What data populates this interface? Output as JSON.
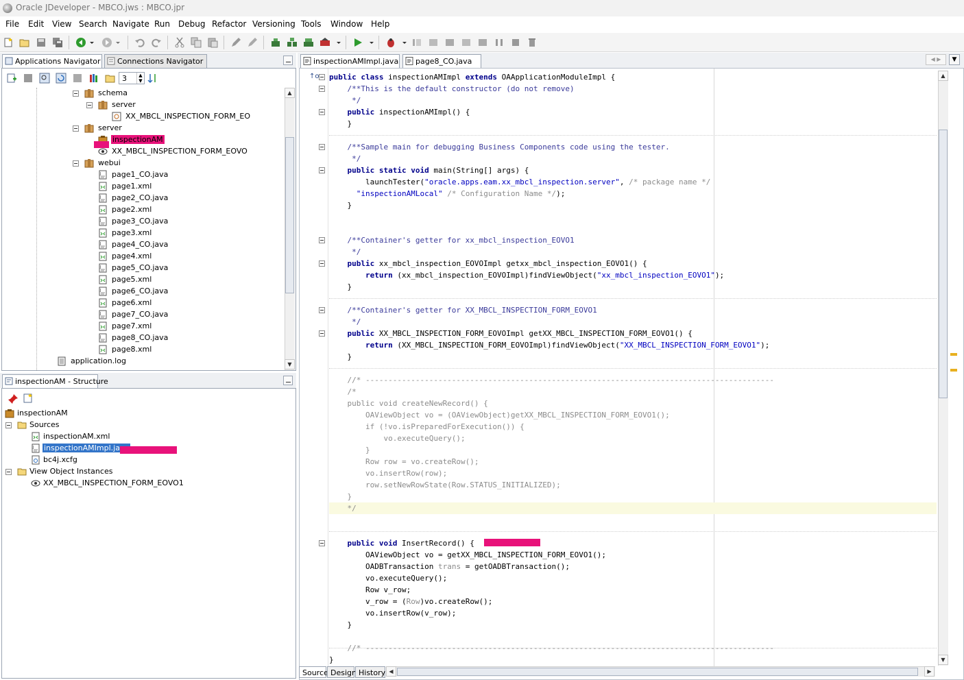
{
  "window": {
    "title": "Oracle JDeveloper - MBCO.jws : MBCO.jpr"
  },
  "menu": [
    "File",
    "Edit",
    "View",
    "Search",
    "Navigate",
    "Run",
    "Debug",
    "Refactor",
    "Versioning",
    "Tools",
    "Window",
    "Help"
  ],
  "navigator": {
    "tabs": [
      "Applications Navigator",
      "Connections Navigator"
    ],
    "level_value": "3",
    "tree": [
      {
        "label": "schema",
        "indent": 0
      },
      {
        "label": "server",
        "indent": 1
      },
      {
        "label": "XX_MBCL_INSPECTION_FORM_EO",
        "indent": 2
      },
      {
        "label": "server",
        "indent": 0
      },
      {
        "label": "inspectionAM",
        "indent": 1
      },
      {
        "label": "XX_MBCL_INSPECTION_FORM_EOVO",
        "indent": 1
      },
      {
        "label": "webui",
        "indent": 0
      },
      {
        "label": "page1_CO.java",
        "indent": 1
      },
      {
        "label": "page1.xml",
        "indent": 1
      },
      {
        "label": "page2_CO.java",
        "indent": 1
      },
      {
        "label": "page2.xml",
        "indent": 1
      },
      {
        "label": "page3_CO.java",
        "indent": 1
      },
      {
        "label": "page3.xml",
        "indent": 1
      },
      {
        "label": "page4_CO.java",
        "indent": 1
      },
      {
        "label": "page4.xml",
        "indent": 1
      },
      {
        "label": "page5_CO.java",
        "indent": 1
      },
      {
        "label": "page5.xml",
        "indent": 1
      },
      {
        "label": "page6_CO.java",
        "indent": 1
      },
      {
        "label": "page6.xml",
        "indent": 1
      },
      {
        "label": "page7_CO.java",
        "indent": 1
      },
      {
        "label": "page7.xml",
        "indent": 1
      },
      {
        "label": "page8_CO.java",
        "indent": 1
      },
      {
        "label": "page8.xml",
        "indent": 1
      },
      {
        "label": "application.log",
        "indent": -1
      }
    ]
  },
  "structure": {
    "title": "inspectionAM - Structure",
    "tree": [
      {
        "label": "inspectionAM"
      },
      {
        "label": "Sources"
      },
      {
        "label": "inspectionAM.xml"
      },
      {
        "label": "inspectionAMImpl.java"
      },
      {
        "label": "bc4j.xcfg"
      },
      {
        "label": "View Object Instances"
      },
      {
        "label": "XX_MBCL_INSPECTION_FORM_EOVO1"
      }
    ]
  },
  "editor": {
    "tabs": [
      "inspectionAMImpl.java",
      "page8_CO.java"
    ],
    "bottom_tabs": [
      "Source",
      "Design",
      "History"
    ],
    "lines": [
      [
        [
          "kw",
          "public class "
        ],
        [
          "plain",
          "inspectionAMImpl "
        ],
        [
          "kw",
          "extends "
        ],
        [
          "plain",
          "OAApplicationModuleImpl {"
        ]
      ],
      [
        [
          "cm",
          "    /**This is the default constructor (do not remove)"
        ]
      ],
      [
        [
          "cm",
          "     */"
        ]
      ],
      [
        [
          "kw",
          "    public "
        ],
        [
          "plain",
          "inspectionAMImpl() {"
        ]
      ],
      [
        [
          "plain",
          "    }"
        ]
      ],
      [
        [
          "plain",
          ""
        ]
      ],
      [
        [
          "cm",
          "    /**Sample main for debugging Business Components code using the tester."
        ]
      ],
      [
        [
          "cm",
          "     */"
        ]
      ],
      [
        [
          "kw",
          "    public static void "
        ],
        [
          "plain",
          "main(String[] args) {"
        ]
      ],
      [
        [
          "plain",
          "        launchTester("
        ],
        [
          "str",
          "\"oracle.apps.eam.xx_mbcl_inspection.server\""
        ],
        [
          "plain",
          ", "
        ],
        [
          "dim",
          "/* package name */"
        ]
      ],
      [
        [
          "plain",
          "      "
        ],
        [
          "str",
          "\"inspectionAMLocal\""
        ],
        [
          "plain",
          " "
        ],
        [
          "dim",
          "/* Configuration Name */"
        ],
        [
          "plain",
          ");"
        ]
      ],
      [
        [
          "plain",
          "    }"
        ]
      ],
      [
        [
          "plain",
          ""
        ]
      ],
      [
        [
          "plain",
          ""
        ]
      ],
      [
        [
          "cm",
          "    /**Container's getter for xx_mbcl_inspection_EOVO1"
        ]
      ],
      [
        [
          "cm",
          "     */"
        ]
      ],
      [
        [
          "kw",
          "    public "
        ],
        [
          "plain",
          "xx_mbcl_inspection_EOVOImpl getxx_mbcl_inspection_EOVO1() {"
        ]
      ],
      [
        [
          "kw",
          "        return "
        ],
        [
          "plain",
          "(xx_mbcl_inspection_EOVOImpl)findViewObject("
        ],
        [
          "str",
          "\"xx_mbcl_inspection_EOVO1\""
        ],
        [
          "plain",
          ");"
        ]
      ],
      [
        [
          "plain",
          "    }"
        ]
      ],
      [
        [
          "plain",
          ""
        ]
      ],
      [
        [
          "cm",
          "    /**Container's getter for XX_MBCL_INSPECTION_FORM_EOVO1"
        ]
      ],
      [
        [
          "cm",
          "     */"
        ]
      ],
      [
        [
          "kw",
          "    public "
        ],
        [
          "plain",
          "XX_MBCL_INSPECTION_FORM_EOVOImpl getXX_MBCL_INSPECTION_FORM_EOVO1() {"
        ]
      ],
      [
        [
          "kw",
          "        return "
        ],
        [
          "plain",
          "(XX_MBCL_INSPECTION_FORM_EOVOImpl)findViewObject("
        ],
        [
          "str",
          "\"XX_MBCL_INSPECTION_FORM_EOVO1\""
        ],
        [
          "plain",
          ");"
        ]
      ],
      [
        [
          "plain",
          "    }"
        ]
      ],
      [
        [
          "plain",
          ""
        ]
      ],
      [
        [
          "dim",
          "    //* ------------------------------------------------------------------------------------------"
        ]
      ],
      [
        [
          "dim",
          "    /*"
        ]
      ],
      [
        [
          "dim",
          "    public void createNewRecord() {"
        ]
      ],
      [
        [
          "dim",
          "        OAViewObject vo = (OAViewObject)getXX_MBCL_INSPECTION_FORM_EOVO1();"
        ]
      ],
      [
        [
          "dim",
          "        if (!vo.isPreparedForExecution()) {"
        ]
      ],
      [
        [
          "dim",
          "            vo.executeQuery();"
        ]
      ],
      [
        [
          "dim",
          "        }"
        ]
      ],
      [
        [
          "dim",
          "        Row row = vo.createRow();"
        ]
      ],
      [
        [
          "dim",
          "        vo.insertRow(row);"
        ]
      ],
      [
        [
          "dim",
          "        row.setNewRowState(Row.STATUS_INITIALIZED);"
        ]
      ],
      [
        [
          "dim",
          "    }"
        ]
      ],
      [
        [
          "dim",
          "    */"
        ]
      ],
      [
        [
          "plain",
          ""
        ]
      ],
      [
        [
          "plain",
          ""
        ]
      ],
      [
        [
          "kw",
          "    public void "
        ],
        [
          "plain",
          "InsertRecord() {"
        ]
      ],
      [
        [
          "plain",
          "        OAViewObject vo = getXX_MBCL_INSPECTION_FORM_EOVO1();"
        ]
      ],
      [
        [
          "plain",
          "        OADBTransaction "
        ],
        [
          "dim",
          "trans"
        ],
        [
          "plain",
          " = getOADBTransaction();"
        ]
      ],
      [
        [
          "plain",
          "        vo.executeQuery();"
        ]
      ],
      [
        [
          "plain",
          "        Row v_row;"
        ]
      ],
      [
        [
          "plain",
          "        v_row = ("
        ],
        [
          "dim",
          "Row"
        ],
        [
          "plain",
          ")vo.createRow();"
        ]
      ],
      [
        [
          "plain",
          "        vo.insertRow(v_row);"
        ]
      ],
      [
        [
          "plain",
          "    }"
        ]
      ],
      [
        [
          "plain",
          ""
        ]
      ],
      [
        [
          "dim",
          "    //* ------------------------------------------------------------------------------------------"
        ]
      ],
      [
        [
          "plain",
          "}"
        ]
      ]
    ]
  }
}
